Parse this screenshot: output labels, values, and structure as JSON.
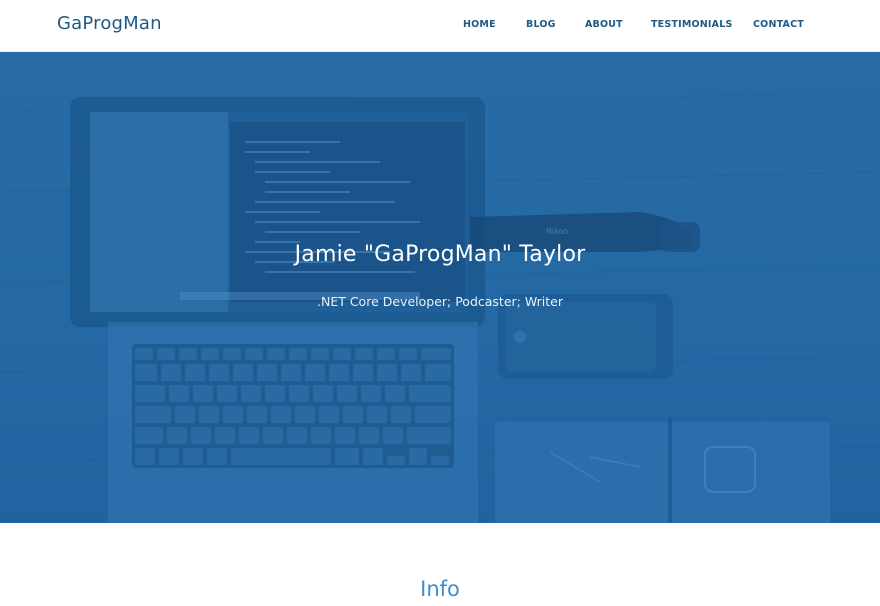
{
  "header": {
    "brand": "GaProgMan",
    "nav": [
      {
        "label": "HOME"
      },
      {
        "label": "BLOG"
      },
      {
        "label": "ABOUT"
      },
      {
        "label": "TESTIMONIALS"
      },
      {
        "label": "CONTACT"
      }
    ]
  },
  "hero": {
    "title": "Jamie \"GaProgMan\" Taylor",
    "subtitle": ".NET Core Developer; Podcaster; Writer",
    "overlay_color": "#2366a3"
  },
  "info": {
    "heading": "Info"
  },
  "colors": {
    "brand": "#1e5a84",
    "hero_overlay": "#2366a3",
    "accent": "#3f8fcb"
  }
}
